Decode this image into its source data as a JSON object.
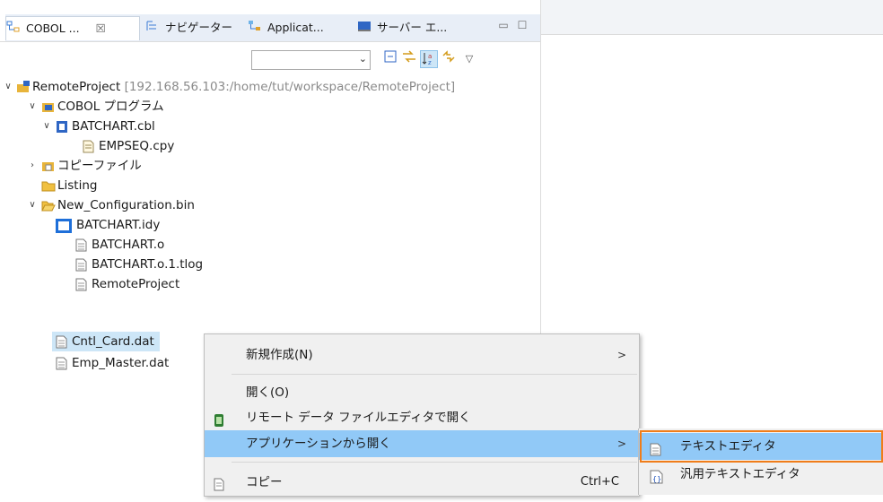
{
  "tabs": [
    {
      "label": "COBOL ...",
      "close": "☒",
      "icon": "cobol-explorer-icon"
    },
    {
      "label": "ナビゲーター",
      "icon": "navigator-icon"
    },
    {
      "label": "Applicat...",
      "icon": "application-icon"
    },
    {
      "label": "サーバー エ...",
      "icon": "server-icon"
    }
  ],
  "toolbar": {
    "combo_value": "",
    "combo_arrow": "⌄"
  },
  "tree": {
    "project": {
      "name": "RemoteProject",
      "path": "[192.168.56.103:/home/tut/workspace/RemoteProject]"
    },
    "cobol_programs": "COBOL プログラム",
    "batchart_cbl": "BATCHART.cbl",
    "empseq_cpy": "EMPSEQ.cpy",
    "copy_files": "コピーファイル",
    "listing": "Listing",
    "new_config": "New_Configuration.bin",
    "batchart_idy": "BATCHART.idy",
    "batchart_o": "BATCHART.o",
    "batchart_tlog": "BATCHART.o.1.tlog",
    "remote_project_file": "RemoteProject",
    "cntl_card": "Cntl_Card.dat",
    "emp_master": "Emp_Master.dat"
  },
  "context_menu": {
    "new": "新規作成(N)",
    "open": "開く(O)",
    "open_remote": "リモート データ ファイルエディタで開く",
    "open_with": "アプリケーションから開く",
    "copy": "コピー",
    "copy_shortcut": "Ctrl+C",
    "submenu_arrow": ">"
  },
  "submenu": {
    "text_editor": "テキストエディタ",
    "generic_text_editor": "汎用テキストエディタ"
  },
  "colors": {
    "selection": "#cde6f7",
    "menu_highlight": "#91c9f7",
    "focus_outline": "#f07d1a"
  }
}
